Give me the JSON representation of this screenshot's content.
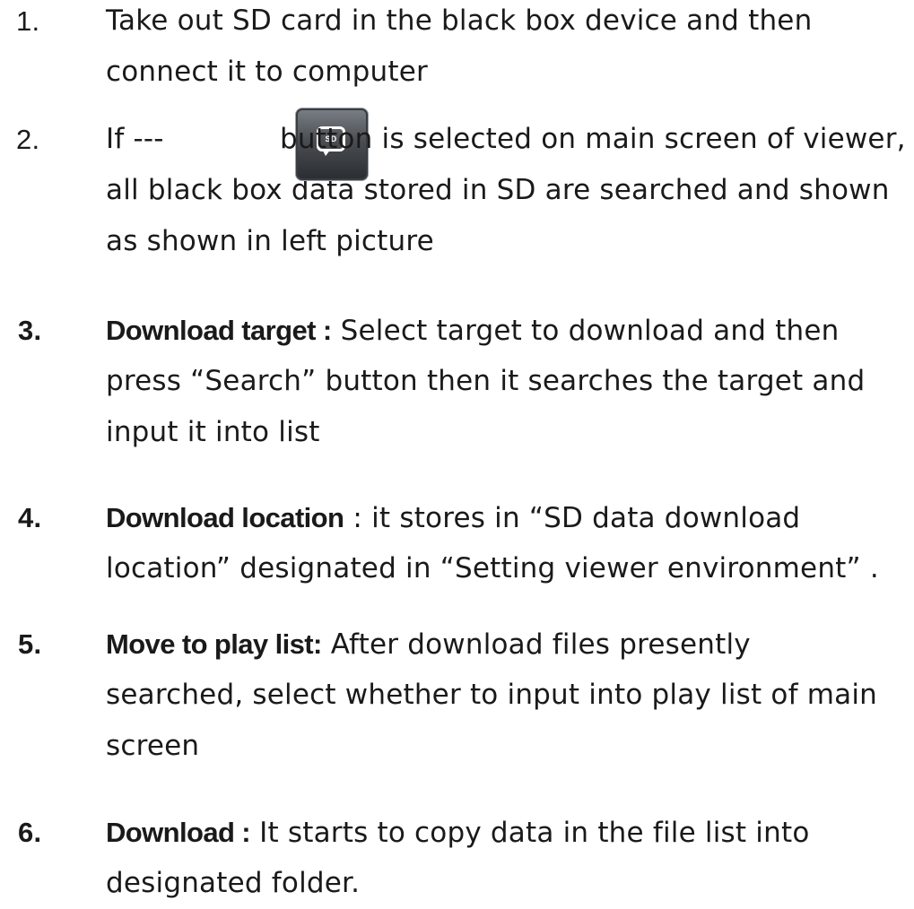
{
  "items": [
    {
      "number": "1.",
      "lines": [
        "Take out SD card in the black box device and then",
        "connect it to computer"
      ]
    },
    {
      "number": "2.",
      "line1_start": "If ---",
      "line1_end": "button is selected on main screen of viewer,",
      "icon": "sd-card-viewer-button",
      "icon_text": "SD",
      "lines": [
        "all black box data stored in SD are searched and shown",
        "as shown in left picture"
      ]
    },
    {
      "number": "3.",
      "term": "Download target :",
      "line1_rest": "Select target to download and then",
      "lines": [
        "press “Search” button then it searches the target and",
        "input it into list"
      ]
    },
    {
      "number": "4.",
      "term": "Download location",
      "line1_rest": ":  it stores in “SD data download",
      "lines": [
        "location” designated in “Setting viewer environment” ."
      ]
    },
    {
      "number": "5.",
      "term": "Move to play list:",
      "line1_rest": "After download files presently",
      "lines": [
        "searched, select whether to input into play list of main",
        "screen"
      ]
    },
    {
      "number": "6.",
      "term": "Download :",
      "line1_rest": "It starts to copy data in the file list into",
      "lines": [
        "designated folder."
      ]
    }
  ]
}
